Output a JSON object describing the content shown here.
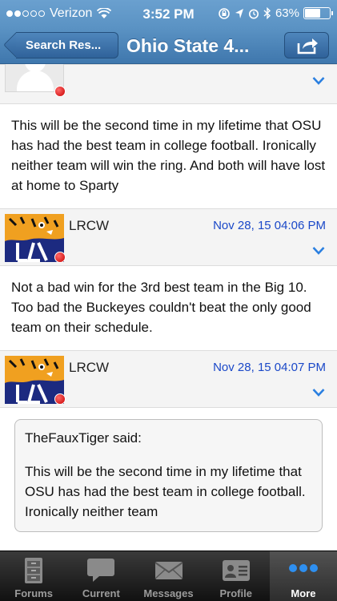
{
  "status_bar": {
    "carrier": "Verizon",
    "time": "3:52 PM",
    "battery": "63%",
    "battery_level": 0.63
  },
  "nav": {
    "back_label": "Search Res...",
    "title": "Ohio State 4..."
  },
  "posts": [
    {
      "body": "This will be the second time in my lifetime that OSU has had the best team in college football. Ironically neither team will win the ring. And both will have lost at home to Sparty"
    },
    {
      "username": "LRCW",
      "date": "Nov 28, 15 04:06 PM",
      "body": "Not a bad win for the 3rd best team in the Big 10. Too bad the Buckeyes couldn't beat the only good team on their schedule."
    },
    {
      "username": "LRCW",
      "date": "Nov 28, 15 04:07 PM",
      "quote_author": "TheFauxTiger said:",
      "quote_text": "This will be the second time in my lifetime that OSU has had the best team in college football. Ironically neither team"
    }
  ],
  "tabs": [
    {
      "label": "Forums",
      "icon": "cabinet-icon"
    },
    {
      "label": "Current",
      "icon": "speech-bubble-icon"
    },
    {
      "label": "Messages",
      "icon": "envelope-icon"
    },
    {
      "label": "Profile",
      "icon": "id-card-icon"
    },
    {
      "label": "More",
      "icon": "more-dots-icon"
    }
  ],
  "colors": {
    "nav_blue": "#4a83bb",
    "date_blue": "#1a48c8",
    "chevron_blue": "#2a7fe0",
    "status_red": "#d40000"
  }
}
